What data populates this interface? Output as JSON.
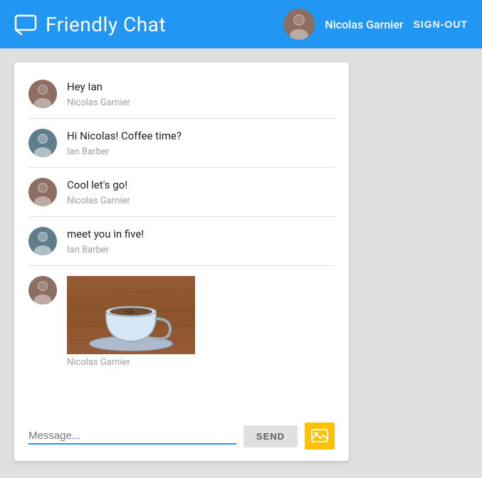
{
  "header": {
    "title": "Friendly Chat",
    "user_name": "Nicolas Garnier",
    "sign_out_label": "SIGN-OUT",
    "icon_symbol": "💬"
  },
  "messages": [
    {
      "id": 1,
      "text": "Hey Ian",
      "sender": "Nicolas Garnier",
      "avatar_type": "nicolas"
    },
    {
      "id": 2,
      "text": "Hi Nicolas! Coffee time?",
      "sender": "Ian Barber",
      "avatar_type": "ian"
    },
    {
      "id": 3,
      "text": "Cool let's go!",
      "sender": "Nicolas Garnier",
      "avatar_type": "nicolas"
    },
    {
      "id": 4,
      "text": "meet you in five!",
      "sender": "Ian Barber",
      "avatar_type": "ian"
    },
    {
      "id": 5,
      "text": "",
      "sender": "Nicolas Garnier",
      "avatar_type": "nicolas",
      "has_image": true
    }
  ],
  "input": {
    "placeholder": "Message...",
    "send_label": "SEND"
  }
}
